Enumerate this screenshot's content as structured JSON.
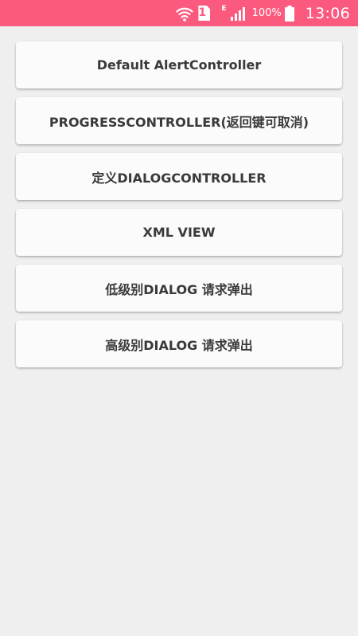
{
  "status_bar": {
    "background_color": "#fb5a7e",
    "sim_label": "1",
    "network_type": "E",
    "battery_percent": "100%",
    "time": "13:06",
    "icons": [
      "wifi-icon",
      "sim-card-icon",
      "signal-icon",
      "battery-icon"
    ]
  },
  "buttons": [
    {
      "label": "Default AlertController"
    },
    {
      "label": "PROGRESSCONTROLLER(返回键可取消)"
    },
    {
      "label": "定义DIALOGCONTROLLER"
    },
    {
      "label": "XML VIEW"
    },
    {
      "label": "低级别DIALOG 请求弹出"
    },
    {
      "label": "高级别DIALOG 请求弹出"
    }
  ],
  "colors": {
    "screen_background": "#efefef",
    "button_background": "#fbfbfb",
    "button_text": "#3a3a3a"
  }
}
